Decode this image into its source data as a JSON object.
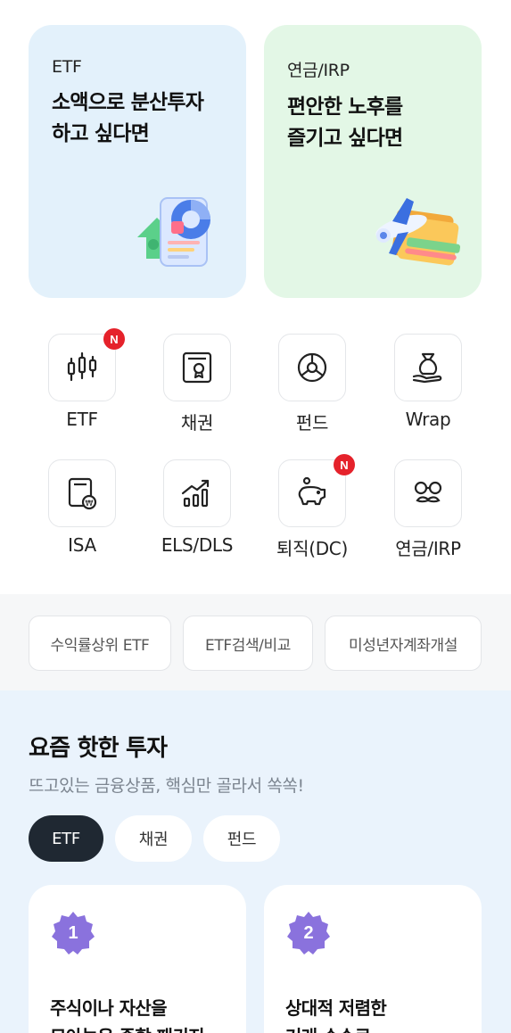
{
  "promos": [
    {
      "eyebrow": "ETF",
      "headline": "소액으로 분산투자\n하고 싶다면",
      "illustration": "chart-report-illustration"
    },
    {
      "eyebrow": "연금/IRP",
      "headline": "편안한 노후를\n즐기고 싶다면",
      "illustration": "airplane-passport-illustration"
    }
  ],
  "menu": [
    {
      "label": "ETF",
      "icon": "candlestick-icon",
      "badge": "N"
    },
    {
      "label": "채권",
      "icon": "bond-certificate-icon",
      "badge": ""
    },
    {
      "label": "펀드",
      "icon": "pie-chart-icon",
      "badge": ""
    },
    {
      "label": "Wrap",
      "icon": "money-bag-hand-icon",
      "badge": ""
    },
    {
      "label": "ISA",
      "icon": "won-account-icon",
      "badge": ""
    },
    {
      "label": "ELS/DLS",
      "icon": "rising-bars-icon",
      "badge": ""
    },
    {
      "label": "퇴직(DC)",
      "icon": "piggy-bank-icon",
      "badge": "N"
    },
    {
      "label": "연금/IRP",
      "icon": "glasses-mustache-icon",
      "badge": ""
    }
  ],
  "quick_links": [
    "수익률상위 ETF",
    "ETF검색/비교",
    "미성년자계좌개설"
  ],
  "hot": {
    "title": "요즘 핫한 투자",
    "subtitle": "뜨고있는 금융상품, 핵심만 골라서 쏙쏙!",
    "tabs": [
      "ETF",
      "채권",
      "펀드"
    ],
    "active_tab": "ETF",
    "cards": [
      {
        "rank": "1",
        "text": "주식이나 자산을\n모아놓은 종합 패키지"
      },
      {
        "rank": "2",
        "text": "상대적 저렴한\n거래 수수료"
      }
    ]
  },
  "colors": {
    "badge": "#e5222b",
    "rank_badge": "#8a72dd",
    "active_chip": "#1f2832"
  }
}
